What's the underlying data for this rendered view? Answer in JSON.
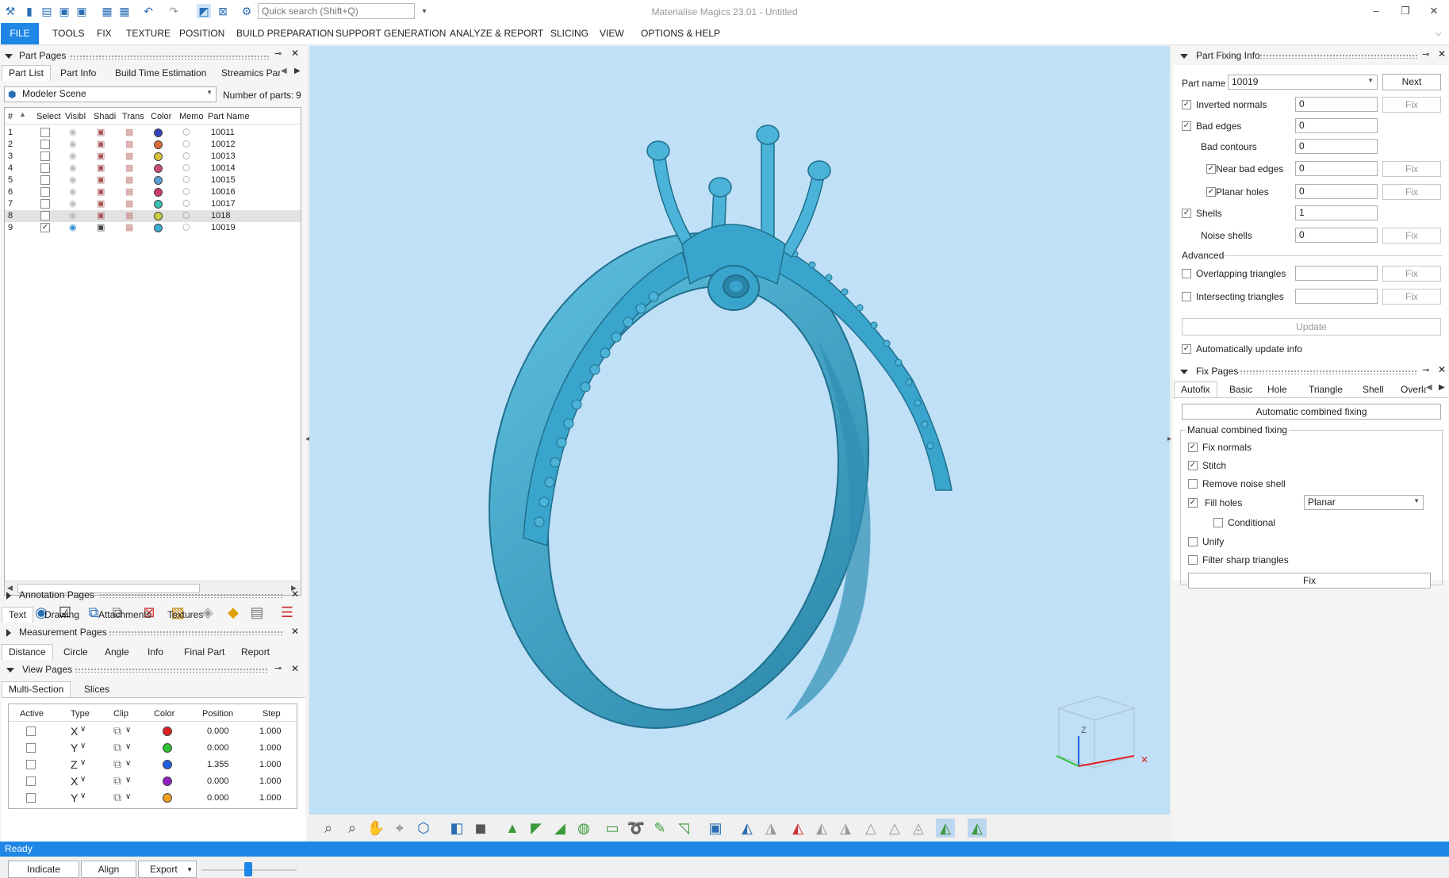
{
  "titlebar": {
    "app_title": "Materialise Magics 23.01 - Untitled",
    "quick_search_placeholder": "Quick search (Shift+Q)",
    "minimize": "–",
    "restore": "❐",
    "close": "✕"
  },
  "menubar": {
    "items": [
      "FILE",
      "TOOLS",
      "FIX",
      "TEXTURE",
      "POSITION",
      "BUILD PREPARATION",
      "SUPPORT GENERATION",
      "ANALYZE & REPORT",
      "SLICING",
      "VIEW",
      "OPTIONS & HELP"
    ]
  },
  "part_pages": {
    "title": "Part Pages",
    "tabs": [
      "Part List",
      "Part Info",
      "Build Time Estimation",
      "Streamics Part"
    ],
    "scene": "Modeler Scene",
    "parts_count_label": "Number of parts:",
    "parts_count": "9",
    "columns": [
      "#",
      "Select",
      "Visibl",
      "Shadi",
      "Trans",
      "Color",
      "Memo",
      "Part Name"
    ],
    "rows": [
      {
        "num": "1",
        "name": "10011",
        "selected": false,
        "color": "#3344bb"
      },
      {
        "num": "2",
        "name": "10012",
        "selected": false,
        "color": "#e06a3a"
      },
      {
        "num": "3",
        "name": "10013",
        "selected": false,
        "color": "#d6c43a"
      },
      {
        "num": "4",
        "name": "10014",
        "selected": false,
        "color": "#c94a7a"
      },
      {
        "num": "5",
        "name": "10015",
        "selected": false,
        "color": "#5aa0d8"
      },
      {
        "num": "6",
        "name": "10016",
        "selected": false,
        "color": "#d03a6a"
      },
      {
        "num": "7",
        "name": "10017",
        "selected": false,
        "color": "#3ac0b0"
      },
      {
        "num": "8",
        "name": "1018",
        "selected": false,
        "color": "#c8d040"
      },
      {
        "num": "9",
        "name": "10019",
        "selected": true,
        "color": "#3aaed0"
      }
    ]
  },
  "annotation_pages": {
    "title": "Annotation Pages",
    "tabs": [
      "Text",
      "Drawing",
      "Attachments",
      "Textures"
    ]
  },
  "measurement_pages": {
    "title": "Measurement Pages",
    "tabs": [
      "Distance",
      "Circle",
      "Angle",
      "Info",
      "Final Part",
      "Report"
    ]
  },
  "view_pages": {
    "title": "View Pages",
    "tabs": [
      "Multi-Section",
      "Slices"
    ],
    "columns": [
      "Active",
      "Type",
      "Clip",
      "Color",
      "Position",
      "Step"
    ],
    "rows": [
      {
        "type": "X",
        "color": "#e02020",
        "position": "0.000",
        "step": "1.000"
      },
      {
        "type": "Y",
        "color": "#30c030",
        "position": "0.000",
        "step": "1.000"
      },
      {
        "type": "Z",
        "color": "#2060e0",
        "position": "1.355",
        "step": "1.000"
      },
      {
        "type": "X",
        "color": "#9020c0",
        "position": "0.000",
        "step": "1.000"
      },
      {
        "type": "Y",
        "color": "#f0a020",
        "position": "0.000",
        "step": "1.000"
      }
    ],
    "buttons": {
      "indicate": "Indicate",
      "align": "Align",
      "export": "Export"
    }
  },
  "part_fixing_info": {
    "title": "Part Fixing Info",
    "part_name_label": "Part name",
    "part_name_value": "10019",
    "next_label": "Next",
    "fix_label": "Fix",
    "rows": [
      {
        "label": "Inverted normals",
        "value": "0",
        "checked": true
      },
      {
        "label": "Bad edges",
        "value": "0",
        "checked": true
      },
      {
        "label": "Bad contours",
        "value": "0"
      },
      {
        "label": "Near bad edges",
        "value": "0",
        "checked": true
      },
      {
        "label": "Planar holes",
        "value": "0",
        "checked": true
      },
      {
        "label": "Shells",
        "value": "1",
        "checked": true
      },
      {
        "label": "Noise shells",
        "value": "0"
      }
    ],
    "advanced_label": "Advanced",
    "overlapping_label": "Overlapping triangles",
    "intersecting_label": "Intersecting triangles",
    "update_label": "Update",
    "auto_update_label": "Automatically update info"
  },
  "fix_pages": {
    "title": "Fix Pages",
    "tabs": [
      "Autofix",
      "Basic",
      "Hole",
      "Triangle",
      "Shell",
      "Overla"
    ],
    "automatic_combined_label": "Automatic combined fixing",
    "manual_group_label": "Manual combined fixing",
    "options": {
      "fix_normals": "Fix normals",
      "stitch": "Stitch",
      "remove_noise": "Remove noise shell",
      "fill_holes": "Fill holes",
      "conditional": "Conditional",
      "unify": "Unify",
      "filter_sharp": "Filter sharp triangles"
    },
    "fill_mode": "Planar",
    "fix_label": "Fix"
  },
  "status": {
    "text": "Ready"
  },
  "colors": {
    "accent": "#1e87e5",
    "model": "#3a9fc4",
    "viewport": "#bfe0f7"
  }
}
